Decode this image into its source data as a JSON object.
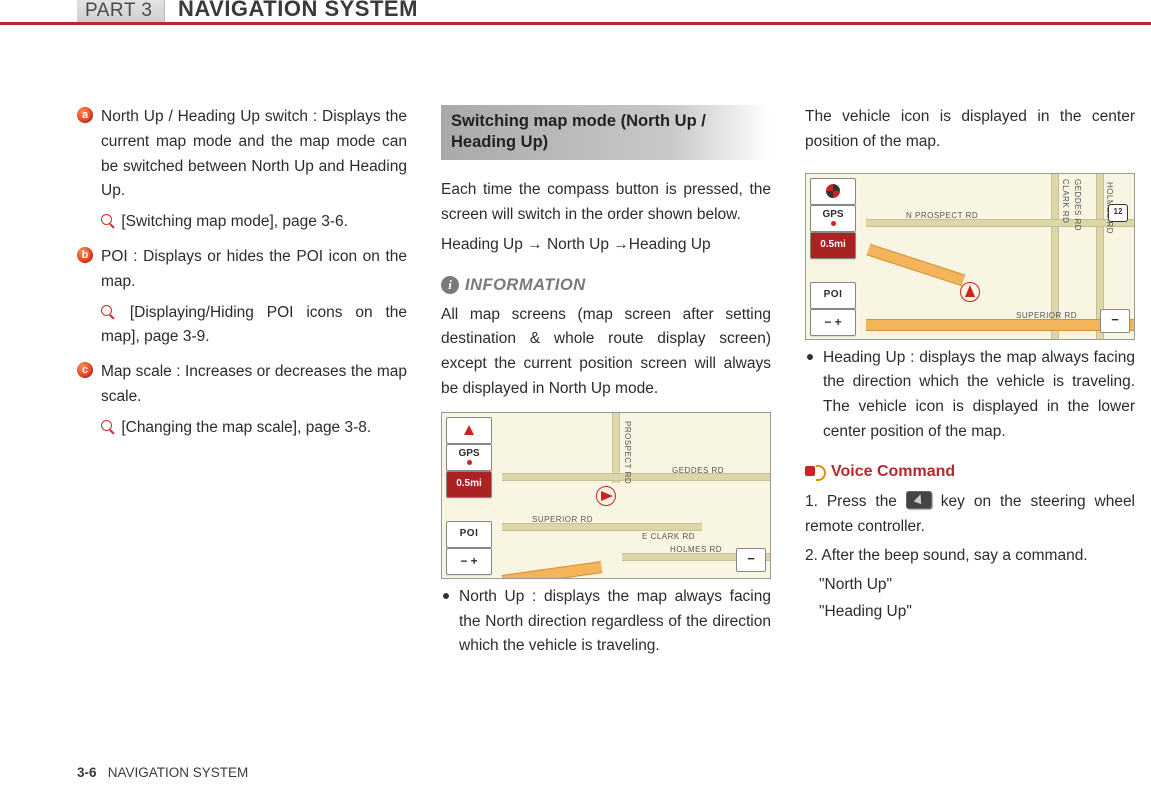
{
  "header": {
    "part_label": "PART 3",
    "title": "NAVIGATION SYSTEM"
  },
  "col1": {
    "a": {
      "badge": "a",
      "text": "North Up / Heading Up switch : Displays the current map mode and the map mode can be switched between North Up and Heading Up.",
      "ref": "[Switching map mode], page 3-6."
    },
    "b": {
      "badge": "b",
      "text": "POI : Displays or hides the POI icon on the map.",
      "ref": "[Displaying/Hiding POI icons on the map], page 3-9."
    },
    "c": {
      "badge": "c",
      "text": "Map scale : Increases or decreases the map scale.",
      "ref": "[Changing the map scale], page 3-8."
    }
  },
  "col2": {
    "section_title": "Switching map mode (North Up / Heading Up)",
    "p1": "Each time the compass button is pressed, the screen will switch in the order shown below.",
    "p2": "Heading Up → North Up  →Heading Up",
    "info_label": "INFORMATION",
    "info_text": "All map screens (map screen after setting destination & whole route display screen) except the current position screen will always be displayed in North Up mode.",
    "map": {
      "gps": "GPS",
      "scale": "0.5mi",
      "poi": "POI",
      "roads": {
        "prospect": "PROSPECT RD",
        "geddes": "GEDDES RD",
        "superior": "SUPERIOR RD",
        "holmes": "HOLMES RD",
        "clark": "E CLARK RD"
      }
    },
    "north_up_desc": "North Up : displays the map always facing the North direction regardless of the direction which the vehicle is traveling."
  },
  "col3": {
    "cont": "The vehicle icon is displayed in the center position of the map.",
    "map": {
      "gps": "GPS",
      "scale": "0.5mi",
      "poi": "POI",
      "roads": {
        "nprospect": "N PROSPECT RD",
        "geddes": "GEDDES RD",
        "superior": "SUPERIOR RD",
        "holmes": "HOLMES RD",
        "clark": "CLARK RD"
      },
      "shield": "12"
    },
    "heading_up_desc": "Heading Up : displays the map always facing the direction which the vehicle is traveling. The vehicle icon is displayed in the lower center position of the map.",
    "voice_label": "Voice Command",
    "step1a": "1. Press the ",
    "step1b": " key on the steering wheel remote controller.",
    "step2": "2. After the beep sound, say a command.",
    "cmd1": "\"North Up\"",
    "cmd2": "\"Heading Up\""
  },
  "footer": {
    "page": "3-6",
    "label": "NAVIGATION SYSTEM"
  }
}
